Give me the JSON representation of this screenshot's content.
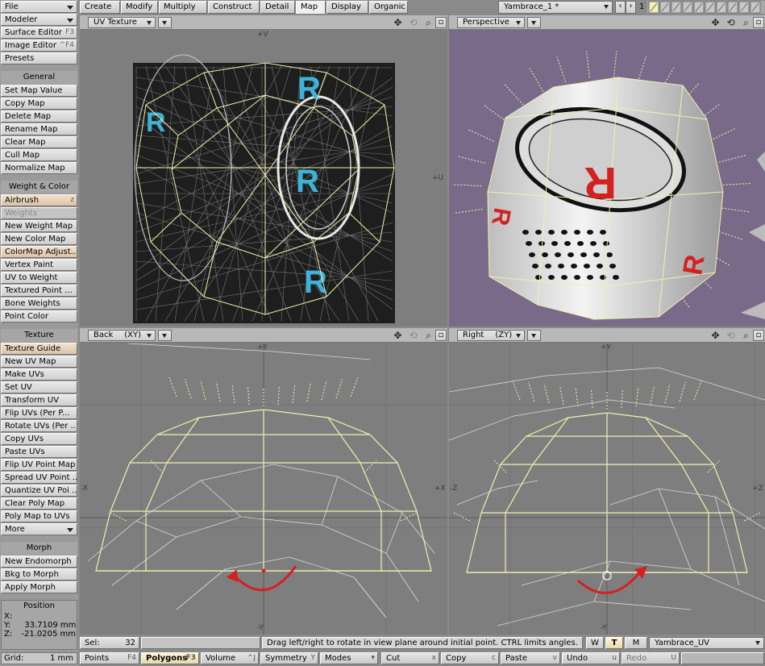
{
  "sidebar": {
    "file": "File",
    "modeler": "Modeler",
    "surface_editor": "Surface Editor",
    "surface_editor_key": "F3",
    "image_editor": "Image Editor",
    "image_editor_key": "^F4",
    "presets": "Presets",
    "general": "General",
    "general_items": [
      "Set Map Value",
      "Copy Map",
      "Delete Map",
      "Rename Map",
      "Clear Map",
      "Cull Map",
      "Normalize Map"
    ],
    "weight_color": "Weight & Color",
    "airbrush": "Airbrush",
    "airbrush_key": "z",
    "weights": "Weights",
    "wc_items": [
      "New Weight Map",
      "New Color Map",
      "ColorMap Adjust...",
      "Vertex Paint",
      "UV to Weight",
      "Textured Point ...",
      "Bone Weights",
      "Point Color"
    ],
    "texture": "Texture",
    "texture_guide": "Texture Guide",
    "tex_items": [
      "New UV Map",
      "Make UVs",
      "Set UV",
      "Transform UV",
      "Flip UVs (Per P...",
      "Rotate UVs (Per ...",
      "Copy UVs",
      "Paste UVs",
      "Flip UV Point Map",
      "Spread UV Point ...",
      "Quantize UV Poi ...",
      "Clear Poly Map",
      "Poly Map to UVs"
    ],
    "more": "More",
    "morph": "Morph",
    "morph_items": [
      "New Endomorph",
      "Bkg to Morph",
      "Apply Morph"
    ],
    "position": {
      "title": "Position",
      "x_label": "X:",
      "x_value": "",
      "y_label": "Y:",
      "y_value": "33.7109 mm",
      "z_label": "Z:",
      "z_value": "-21.0205 mm"
    },
    "grid_label": "Grid:",
    "grid_value": "1 mm"
  },
  "tabs": [
    "Create",
    "Modify",
    "Multiply",
    "Construct",
    "Detail",
    "Map",
    "Display",
    "Organic"
  ],
  "active_tab": "Map",
  "object_select": "Yambrace_1 *",
  "layer_number": "1",
  "viewports": {
    "uv": {
      "view": "UV Texture",
      "axis_top": "+V",
      "axis_right": "+U"
    },
    "persp": {
      "view": "Perspective"
    },
    "back": {
      "view": "Back",
      "plane": "(XY)",
      "axis_top": "+Y",
      "axis_left": "-X",
      "axis_right": "+X",
      "axis_bottom": "-Y"
    },
    "right": {
      "view": "Right",
      "plane": "(ZY)",
      "axis_top": "+Y",
      "axis_left": "-Z",
      "axis_right": "+Z",
      "axis_bottom": "-Y"
    }
  },
  "status": {
    "sel_label": "Sel:",
    "sel_count": "32",
    "message": "Drag left/right to rotate in view plane around initial point. CTRL limits angles.",
    "w": "W",
    "t": "T",
    "m": "M",
    "map_select": "Yambrace_UV"
  },
  "bottom": {
    "points": "Points",
    "points_key": "F4",
    "polygons": "Polygons",
    "polygons_key": "F3",
    "volume": "Volume",
    "volume_key": "^J",
    "symmetry": "Symmetry",
    "symmetry_key": "Y",
    "modes": "Modes",
    "cut": "Cut",
    "cut_key": "x",
    "copy": "Copy",
    "copy_key": "c",
    "paste": "Paste",
    "paste_key": "v",
    "undo": "Undo",
    "undo_key": "u",
    "redo": "Redo",
    "redo_key": "U"
  },
  "colors": {
    "viewport_bg": "#7e7e7e",
    "persp_bg": "#7a6a8a",
    "wire_selected": "#f0f0b0",
    "wire": "#d8d8d8",
    "uv_letter": "#3fb2d8",
    "persp_letter": "#d42020",
    "rotate_arrow": "#d42020",
    "active_tab": "#f0f0f0"
  }
}
